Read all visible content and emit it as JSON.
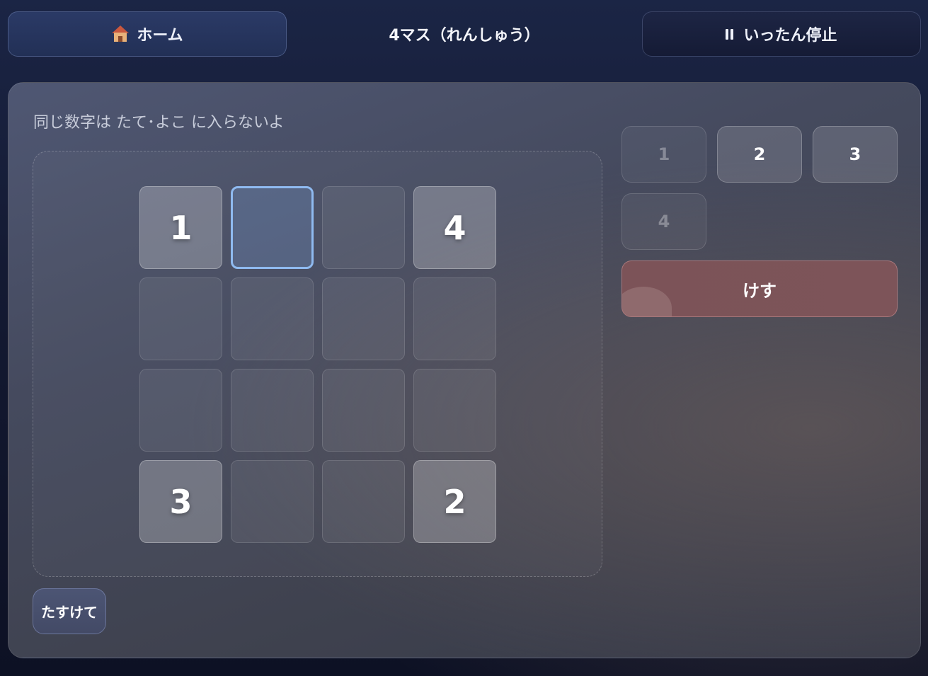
{
  "header": {
    "home_label": "ホーム",
    "home_icon": "house-icon",
    "title": "4マス（れんしゅう）",
    "pause_label": "いったん停止",
    "pause_icon": "pause-icon"
  },
  "board": {
    "hint": "同じ数字は たて･よこ に入らないよ",
    "selected": [
      0,
      1
    ],
    "cells": [
      [
        "1",
        "",
        "",
        "4"
      ],
      [
        "",
        "",
        "",
        ""
      ],
      [
        "",
        "",
        "",
        ""
      ],
      [
        "3",
        "",
        "",
        "2"
      ]
    ]
  },
  "numpad": {
    "buttons": [
      {
        "label": "1",
        "enabled": false
      },
      {
        "label": "2",
        "enabled": true
      },
      {
        "label": "3",
        "enabled": true
      },
      {
        "label": "4",
        "enabled": false
      }
    ],
    "erase_label": "けす",
    "erase_color": "#7c5358"
  },
  "help_label": "たすけて",
  "colors": {
    "selected_border": "#8fbaf0",
    "home_button": "#2b3a66"
  }
}
